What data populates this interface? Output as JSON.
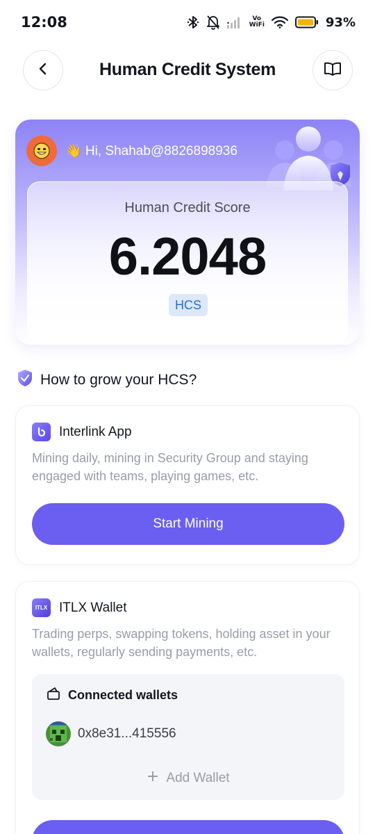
{
  "status_bar": {
    "time": "12:08",
    "vowifi_top": "Vo",
    "vowifi_bottom": "WiFi",
    "battery_percent": "93%",
    "icons": [
      "bluetooth-icon",
      "bell-off-icon",
      "signal-icon",
      "wifi-icon",
      "battery-icon"
    ]
  },
  "header": {
    "title": "Human Credit System",
    "back_icon": "chevron-left-icon",
    "book_icon": "book-open-icon"
  },
  "score_card": {
    "greeting": "👋 Hi, Shahab@8826898936",
    "label": "Human Credit Score",
    "value": "6.2048",
    "badge": "HCS"
  },
  "grow_section": {
    "title": "How to grow your HCS?"
  },
  "interlink_card": {
    "title": "Interlink App",
    "description": "Mining daily, mining in Security Group and staying engaged with teams, playing games, etc.",
    "button_label": "Start Mining"
  },
  "wallet_card": {
    "title": "ITLX Wallet",
    "icon_text": "ITLX",
    "description": "Trading perps, swapping tokens, holding asset in your wallets, regularly sending payments, etc.",
    "connected_title": "Connected wallets",
    "wallets": [
      {
        "address": "0x8e31...415556"
      }
    ],
    "add_wallet_label": "Add Wallet"
  },
  "colors": {
    "accent": "#6a5ff0",
    "badge_bg": "#dde8fb",
    "badge_text": "#2a6fd8",
    "avatar_bg": "#f06a3a"
  }
}
